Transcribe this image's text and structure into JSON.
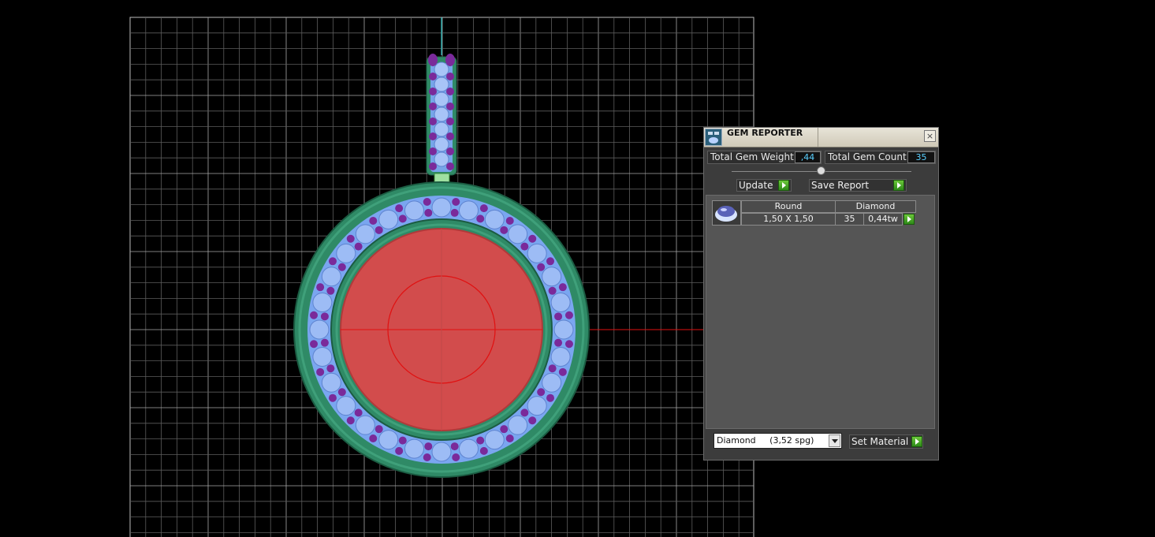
{
  "panel": {
    "title": "GEM REPORTER",
    "close_glyph": "×",
    "total_gem_weight_label": "Total Gem Weight",
    "total_gem_weight_value": ",44",
    "total_gem_count_label": "Total Gem Count",
    "total_gem_count_value": "35",
    "update_label": "Update",
    "save_report_label": "Save Report",
    "table": {
      "headers": [
        "Round",
        "Diamond"
      ],
      "rows": [
        {
          "size": "1,50 X 1,50",
          "count": "35",
          "weight": "0,44tw"
        }
      ]
    },
    "material_select_value": "Diamond     (3,52 spg)",
    "set_material_label": "Set Material"
  },
  "colors": {
    "background": "#000000",
    "grid_line": "#9a9a9a",
    "metal_green": "#2f8a66",
    "gem_blue": "#7aa6f0",
    "prong_purple": "#7a2a9a",
    "center_red": "#d24c4c",
    "axis_red": "#e01010",
    "axis_cyan": "#29c6c6",
    "value_cyan": "#5ad0ff",
    "go_green": "#3aa020"
  },
  "icons": [
    "gem-reporter-app-icon",
    "close-icon",
    "go-arrow-icon",
    "round-gem-thumbnail",
    "dropdown-arrow-icon"
  ]
}
